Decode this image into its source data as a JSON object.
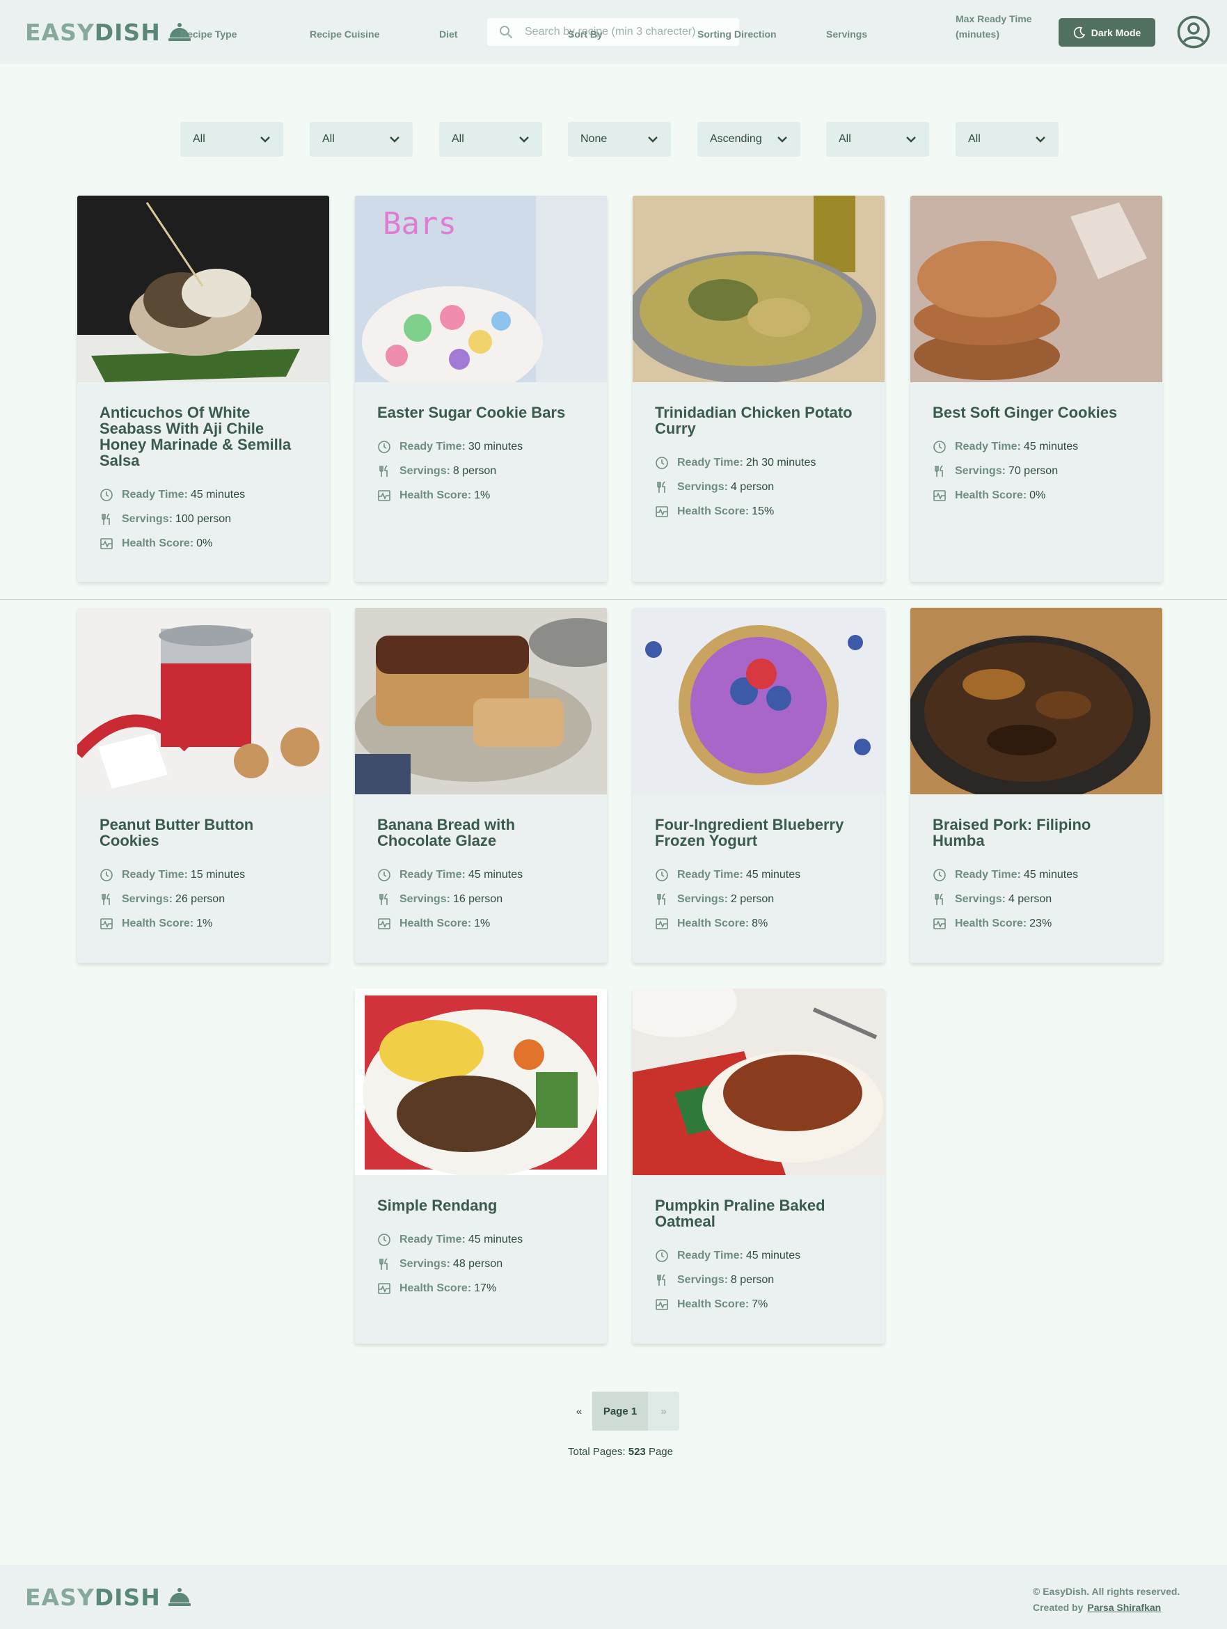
{
  "header": {
    "logo_easy": "EASY",
    "logo_dish": "DISH",
    "search_placeholder": "Search by recipe (min 3 charecter)",
    "dark_mode_label": "Dark Mode"
  },
  "filters": [
    {
      "label": "Recipe Type",
      "value": "All"
    },
    {
      "label": "Recipe Cuisine",
      "value": "All"
    },
    {
      "label": "Diet",
      "value": "All"
    },
    {
      "label": "Sort By",
      "value": "None"
    },
    {
      "label": "Sorting Direction",
      "value": "Ascending"
    },
    {
      "label": "Servings",
      "value": "All"
    },
    {
      "label": "Max Ready Time (minutes)",
      "value": "All"
    }
  ],
  "meta_labels": {
    "ready": "Ready Time:",
    "servings": "Servings:",
    "health": "Health Score:"
  },
  "recipes": [
    {
      "title": "Anticuchos Of White Seabass With Aji Chile Honey Marinade & Semilla Salsa",
      "ready": "45 minutes",
      "servings": "100 person",
      "health": "0%"
    },
    {
      "title": "Easter Sugar Cookie Bars",
      "ready": "30 minutes",
      "servings": "8 person",
      "health": "1%"
    },
    {
      "title": "Trinidadian Chicken Potato Curry",
      "ready": "2h 30 minutes",
      "servings": "4 person",
      "health": "15%"
    },
    {
      "title": "Best Soft Ginger Cookies",
      "ready": "45 minutes",
      "servings": "70 person",
      "health": "0%"
    },
    {
      "title": "Peanut Butter Button Cookies",
      "ready": "15 minutes",
      "servings": "26 person",
      "health": "1%"
    },
    {
      "title": "Banana Bread with Chocolate Glaze",
      "ready": "45 minutes",
      "servings": "16 person",
      "health": "1%"
    },
    {
      "title": "Four-Ingredient Blueberry Frozen Yogurt",
      "ready": "45 minutes",
      "servings": "2 person",
      "health": "8%"
    },
    {
      "title": "Braised Pork: Filipino Humba",
      "ready": "45 minutes",
      "servings": "4 person",
      "health": "23%"
    },
    {
      "title": "Simple Rendang",
      "ready": "45 minutes",
      "servings": "48 person",
      "health": "17%"
    },
    {
      "title": "Pumpkin Praline Baked Oatmeal",
      "ready": "45 minutes",
      "servings": "8 person",
      "health": "7%"
    }
  ],
  "pagination": {
    "prev": "«",
    "current": "Page 1",
    "next": "»",
    "total_prefix": "Total Pages:",
    "total_pages": "523",
    "total_suffix": "Page"
  },
  "footer": {
    "copyright": "© EasyDish. All rights reserved.",
    "created_by": "Created by",
    "author": "Parsa Shirafkan"
  }
}
